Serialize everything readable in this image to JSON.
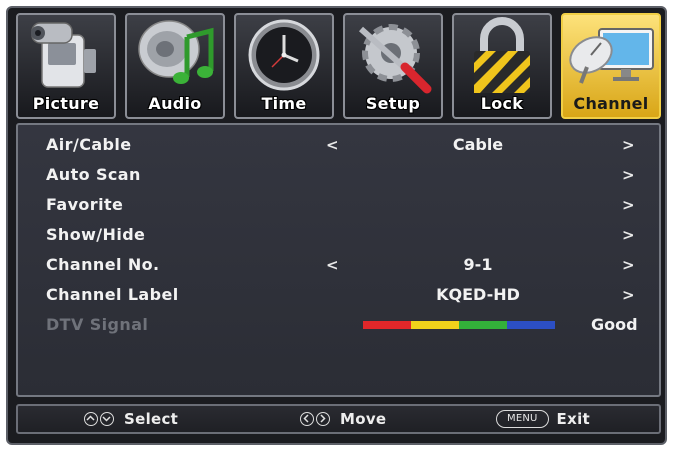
{
  "tabs": [
    {
      "label": "Picture",
      "icon": "camcorder-icon",
      "active": false
    },
    {
      "label": "Audio",
      "icon": "speaker-music-icon",
      "active": false
    },
    {
      "label": "Time",
      "icon": "clock-icon",
      "active": false
    },
    {
      "label": "Setup",
      "icon": "gear-tools-icon",
      "active": false
    },
    {
      "label": "Lock",
      "icon": "padlock-icon",
      "active": false
    },
    {
      "label": "Channel",
      "icon": "satellite-monitor-icon",
      "active": true
    }
  ],
  "menu": {
    "air_cable": {
      "label": "Air/Cable",
      "value": "Cable",
      "left_arrow": "<",
      "right_arrow": ">"
    },
    "auto_scan": {
      "label": "Auto Scan",
      "right_arrow": ">"
    },
    "favorite": {
      "label": "Favorite",
      "right_arrow": ">"
    },
    "show_hide": {
      "label": "Show/Hide",
      "right_arrow": ">"
    },
    "channel_no": {
      "label": "Channel No.",
      "value": "9-1",
      "left_arrow": "<",
      "right_arrow": ">"
    },
    "channel_label": {
      "label": "Channel Label",
      "value": "KQED-HD",
      "right_arrow": ">"
    },
    "dtv_signal": {
      "label": "DTV Signal",
      "value": "Good",
      "disabled": true,
      "bar_colors": [
        "#e0272a",
        "#f0d21b",
        "#33b03a",
        "#2c4fc4"
      ]
    }
  },
  "footer": {
    "select": {
      "label": "Select"
    },
    "move": {
      "label": "Move"
    },
    "exit": {
      "key": "MENU",
      "label": "Exit"
    }
  },
  "colors": {
    "active_tab": "#f5c531",
    "panel": "#30323a",
    "text": "#f2f2f2",
    "disabled_text": "#6f727a"
  }
}
